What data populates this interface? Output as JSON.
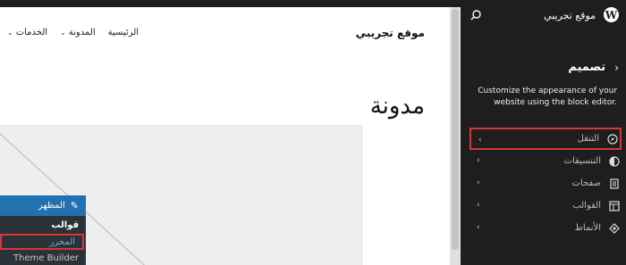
{
  "preview": {
    "site_title": "موقع تجريبي",
    "nav": [
      {
        "label": "الرئيسية",
        "has_dropdown": false
      },
      {
        "label": "المدونة",
        "has_dropdown": true
      },
      {
        "label": "الخدمات",
        "has_dropdown": true
      }
    ],
    "heading": "مدونة"
  },
  "admin_menu": {
    "header": "المظهر",
    "items": [
      {
        "label": "قوالب",
        "style": "bold"
      },
      {
        "label": "المحرر",
        "style": "active"
      },
      {
        "label": "Theme Builder",
        "style": "normal"
      }
    ]
  },
  "sidebar": {
    "site_name": "موقع تجريبي",
    "title": "تصميم",
    "description": "Customize the appearance of your website using the block editor.",
    "items": [
      {
        "label": "التنقل",
        "icon": "navigation-compass-icon",
        "active": true
      },
      {
        "label": "التنسيقات",
        "icon": "styles-half-circle-icon",
        "active": false
      },
      {
        "label": "صفحات",
        "icon": "pages-icon",
        "active": false
      },
      {
        "label": "القوالب",
        "icon": "templates-layout-icon",
        "active": false
      },
      {
        "label": "الأنماط",
        "icon": "patterns-diamond-icon",
        "active": false
      }
    ]
  },
  "colors": {
    "sidebar_bg": "#1e1e1e",
    "highlight_border": "#d63638",
    "admin_blue": "#2271b1"
  }
}
